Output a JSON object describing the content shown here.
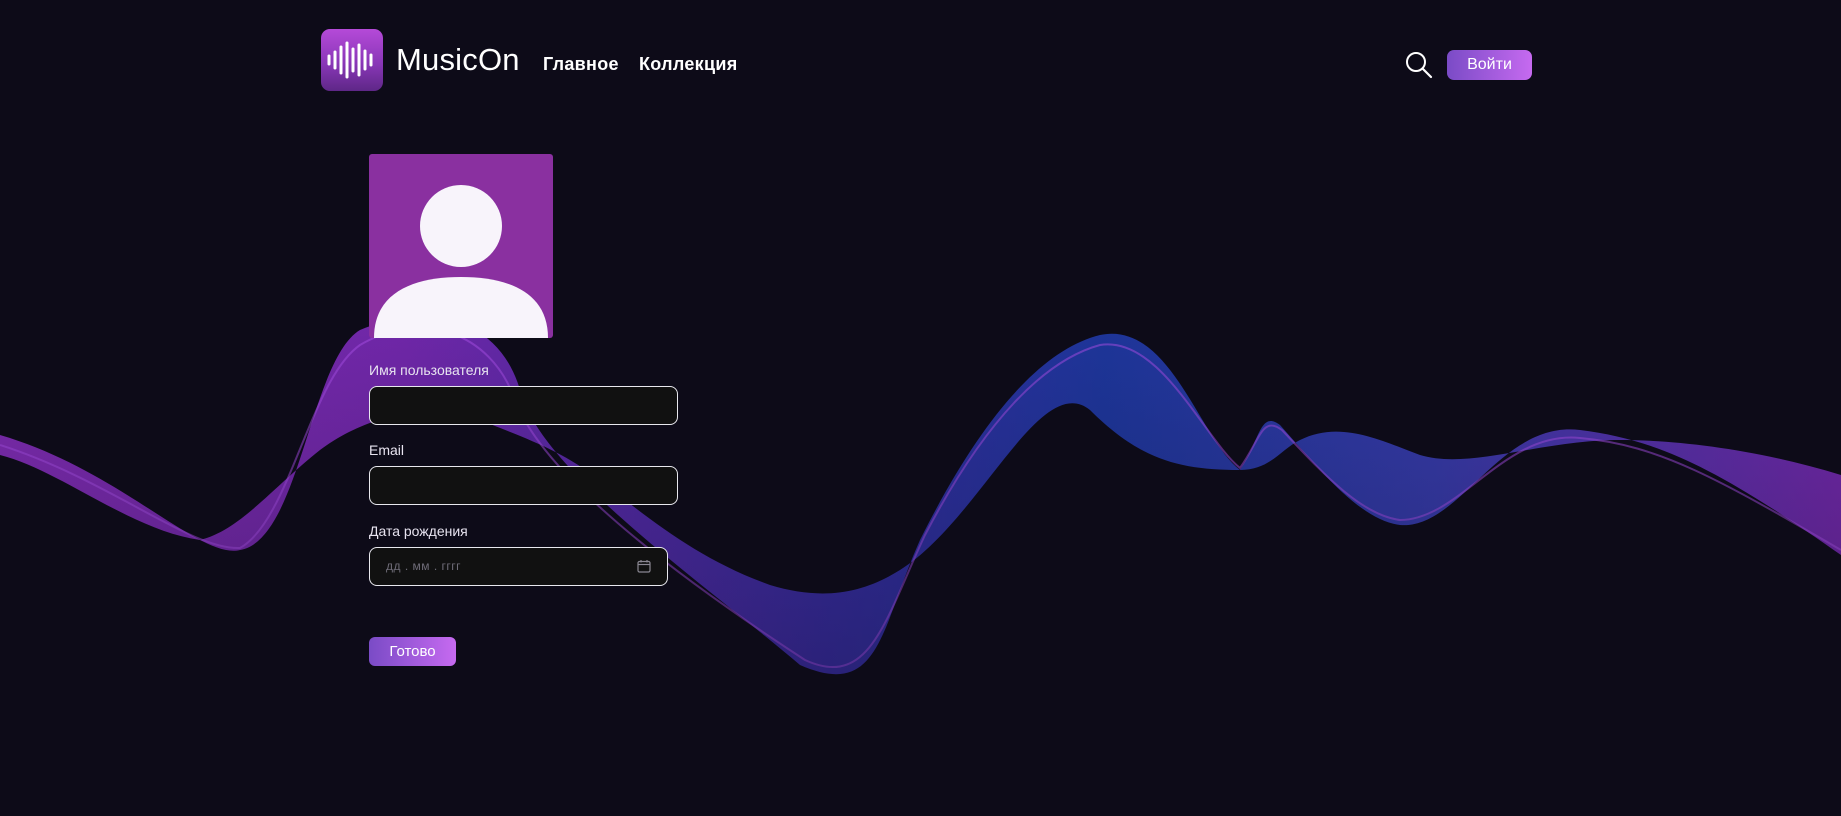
{
  "header": {
    "app_name": "MusicOn",
    "nav": [
      {
        "label": "Главное"
      },
      {
        "label": "Коллекция"
      }
    ],
    "login_label": "Войти"
  },
  "form": {
    "username_label": "Имя пользователя",
    "username_value": "",
    "email_label": "Email",
    "email_value": "",
    "birthdate_label": "Дата рождения",
    "birthdate_placeholder": "дд . мм . гггг",
    "submit_label": "Готово"
  },
  "icons": {
    "logo": "waveform-icon",
    "search": "search-icon",
    "avatar": "user-placeholder-icon",
    "calendar": "calendar-icon"
  },
  "colors": {
    "background": "#0d0b18",
    "accent_start": "#7a4bc6",
    "accent_end": "#c66af0",
    "avatar_bg": "#8a30a0",
    "wave_purple": "#7b2bb8",
    "wave_blue": "#2a3ab0"
  }
}
